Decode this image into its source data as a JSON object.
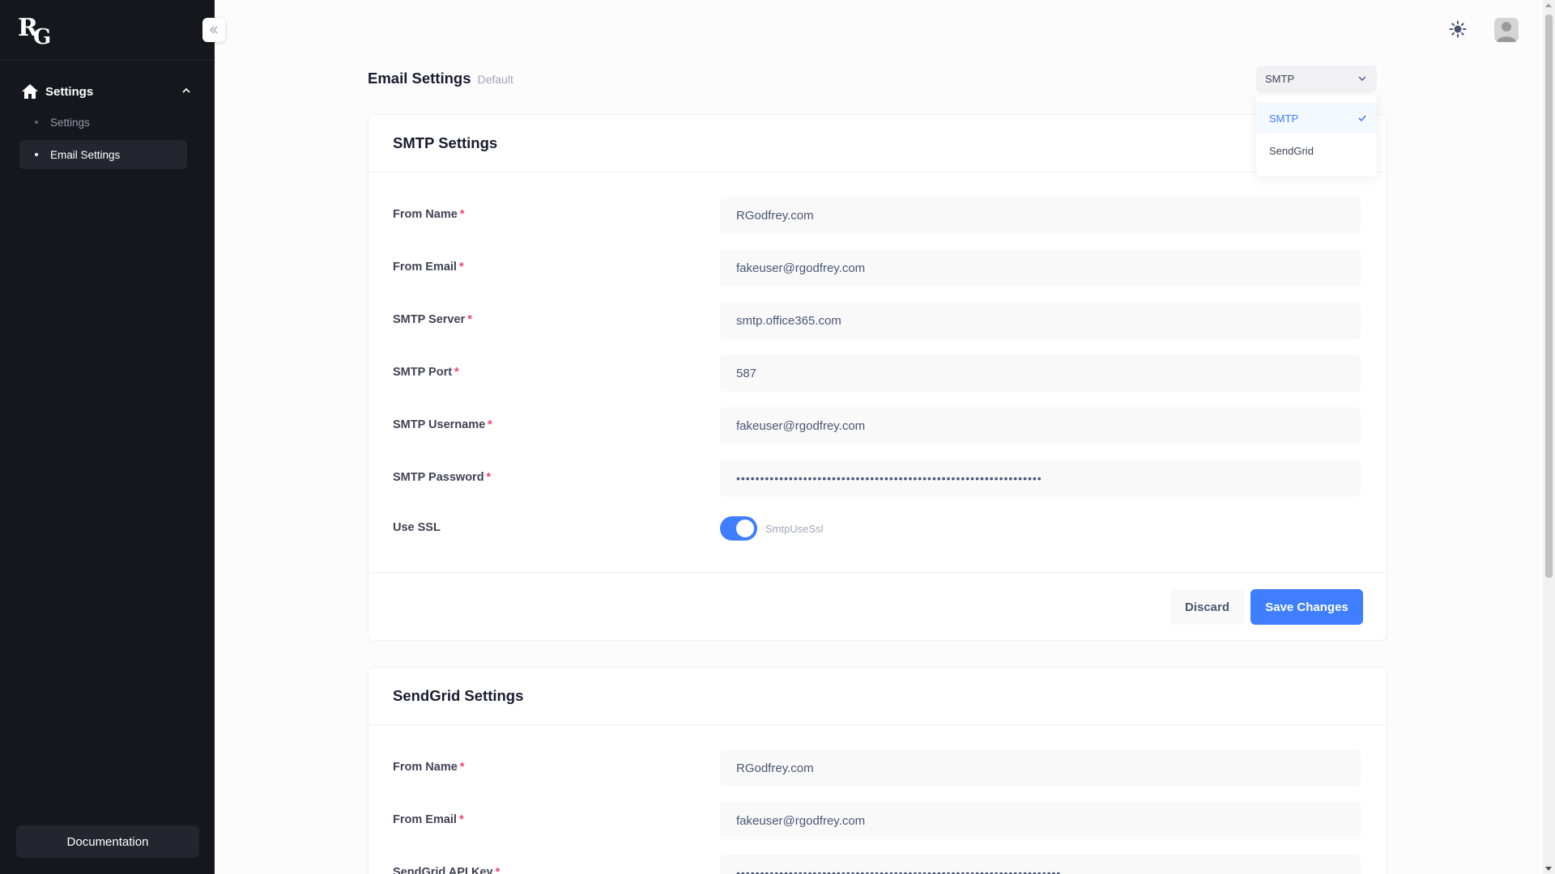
{
  "app": {
    "logo_text_r": "R",
    "logo_text_g": "G"
  },
  "sidebar": {
    "parent_label": "Settings",
    "items": [
      {
        "label": "Settings"
      },
      {
        "label": "Email Settings"
      }
    ],
    "documentation_label": "Documentation"
  },
  "page": {
    "title": "Email Settings",
    "subtitle": "Default"
  },
  "provider_select": {
    "value": "SMTP",
    "options": [
      "SMTP",
      "SendGrid"
    ]
  },
  "smtp": {
    "title": "SMTP Settings",
    "fields": [
      {
        "label": "From Name",
        "value": "RGodfrey.com"
      },
      {
        "label": "From Email",
        "value": "fakeuser@rgodfrey.com"
      },
      {
        "label": "SMTP Server",
        "value": "smtp.office365.com"
      },
      {
        "label": "SMTP Port",
        "value": "587"
      },
      {
        "label": "SMTP Username",
        "value": "fakeuser@rgodfrey.com"
      },
      {
        "label": "SMTP Password",
        "value": "••••••••••••••••••••••••••••••••••••••••••••••••••••••••••••••••"
      }
    ],
    "ssl_label": "Use SSL",
    "ssl_toggle_label": "SmtpUseSsl",
    "ssl_enabled": true,
    "discard_label": "Discard",
    "save_label": "Save Changes"
  },
  "sendgrid": {
    "title": "SendGrid Settings",
    "fields": [
      {
        "label": "From Name",
        "value": "RGodfrey.com"
      },
      {
        "label": "From Email",
        "value": "fakeuser@rgodfrey.com"
      },
      {
        "label": "SendGrid API Key",
        "value": "••••••••••••••••••••••••••••••••••••••••••••••••••••••••••••••••••••"
      }
    ]
  },
  "required_marker": "*",
  "colors": {
    "sidebar_bg": "#15171c",
    "accent": "#3e7eff",
    "required": "#f1416c"
  }
}
